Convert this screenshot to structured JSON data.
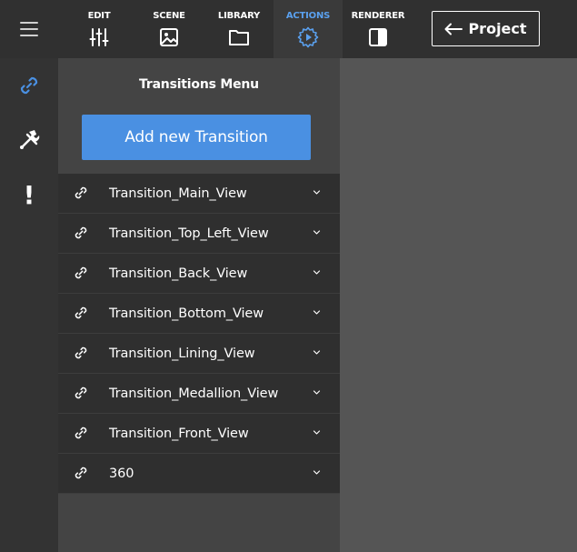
{
  "topbar": {
    "menu_icon": "hamburger-icon",
    "nav": [
      {
        "label": "EDIT",
        "icon": "sliders-icon"
      },
      {
        "label": "SCENE",
        "icon": "image-icon"
      },
      {
        "label": "LIBRARY",
        "icon": "folder-icon"
      },
      {
        "label": "ACTIONS",
        "icon": "play-gear-icon",
        "active": true
      },
      {
        "label": "RENDERER",
        "icon": "half-square-icon"
      }
    ],
    "project_button": {
      "label": "Project",
      "icon": "arrow-left-icon"
    }
  },
  "leftrail": {
    "items": [
      {
        "icon": "link-icon",
        "active": true
      },
      {
        "icon": "tools-icon"
      },
      {
        "icon": "exclamation-icon",
        "glyph": "!"
      }
    ]
  },
  "panel": {
    "title": "Transitions Menu",
    "add_button": "Add new Transition",
    "transitions": [
      "Transition_Main_View",
      "Transition_Top_Left_View",
      "Transition_Back_View",
      "Transition_Bottom_View",
      "Transition_Lining_View",
      "Transition_Medallion_View",
      "Transition_Front_View",
      "360"
    ]
  },
  "colors": {
    "accent": "#4a90e2",
    "active_label": "#5aa0ee",
    "topbar": "#303030",
    "panel": "#444444",
    "row": "#2f2f2f",
    "canvas": "#555555"
  }
}
